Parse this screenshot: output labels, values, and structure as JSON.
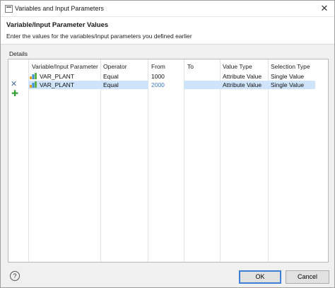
{
  "window": {
    "title": "Variables and Input Parameters",
    "close_glyph": "✕"
  },
  "header": {
    "title": "Variable/Input Parameter Values",
    "description": "Enter the values for the variables/input parameters you defined earlier"
  },
  "details_label": "Details",
  "table": {
    "columns": [
      "Variable/Input Parameter",
      "Operator",
      "From",
      "To",
      "Value Type",
      "Selection Type"
    ],
    "rows": [
      {
        "variable": "VAR_PLANT",
        "operator": "Equal",
        "from": "1000",
        "to": "",
        "value_type": "Attribute Value",
        "selection_type": "Single Value"
      },
      {
        "variable": "VAR_PLANT",
        "operator": "Equal",
        "from": "2000",
        "to": "",
        "value_type": "Attribute Value",
        "selection_type": "Single Value"
      }
    ],
    "selected_row": 1,
    "row_icons": [
      "delete-icon",
      "add-icon"
    ]
  },
  "footer": {
    "help_label": "?",
    "ok_label": "OK",
    "cancel_label": "Cancel"
  },
  "colors": {
    "selection": "#cfe4fb",
    "edit_text": "#3a7bd5",
    "add_icon": "#3aa03a"
  }
}
